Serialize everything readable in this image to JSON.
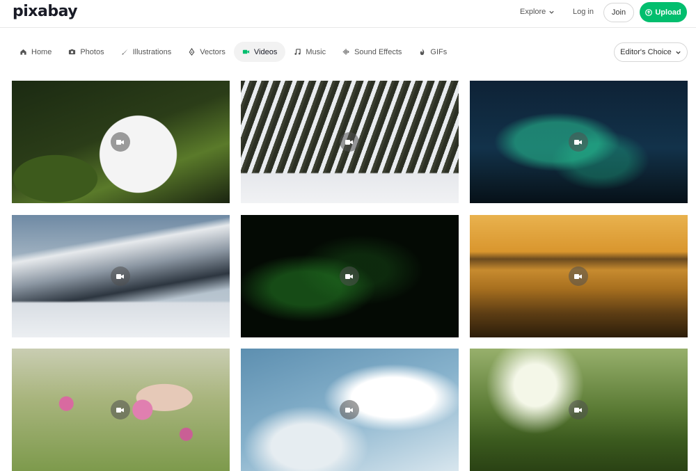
{
  "header": {
    "logo": "pixabay",
    "explore_label": "Explore",
    "login_label": "Log in",
    "join_label": "Join",
    "upload_label": "Upload",
    "accent_color": "#02be6e"
  },
  "nav": {
    "items": [
      {
        "label": "Home",
        "icon": "home-icon"
      },
      {
        "label": "Photos",
        "icon": "camera-icon"
      },
      {
        "label": "Illustrations",
        "icon": "brush-icon"
      },
      {
        "label": "Vectors",
        "icon": "pen-nib-icon"
      },
      {
        "label": "Videos",
        "icon": "video-camera-icon",
        "active": true
      },
      {
        "label": "Music",
        "icon": "music-note-icon"
      },
      {
        "label": "Sound Effects",
        "icon": "waveform-icon"
      },
      {
        "label": "GIFs",
        "icon": "flame-icon"
      }
    ],
    "sort_label": "Editor's Choice"
  },
  "videos": [
    {
      "subject": "christmas ornament",
      "icon": "video-camera-icon"
    },
    {
      "subject": "snowy forest",
      "icon": "video-camera-icon"
    },
    {
      "subject": "aurora",
      "icon": "video-camera-icon"
    },
    {
      "subject": "snowy mountains",
      "icon": "video-camera-icon"
    },
    {
      "subject": "green particles",
      "icon": "video-camera-icon"
    },
    {
      "subject": "sunset water",
      "icon": "video-camera-icon"
    },
    {
      "subject": "pink flowers",
      "icon": "video-camera-icon"
    },
    {
      "subject": "clouds sky",
      "icon": "video-camera-icon"
    },
    {
      "subject": "grass bokeh",
      "icon": "video-camera-icon"
    }
  ]
}
